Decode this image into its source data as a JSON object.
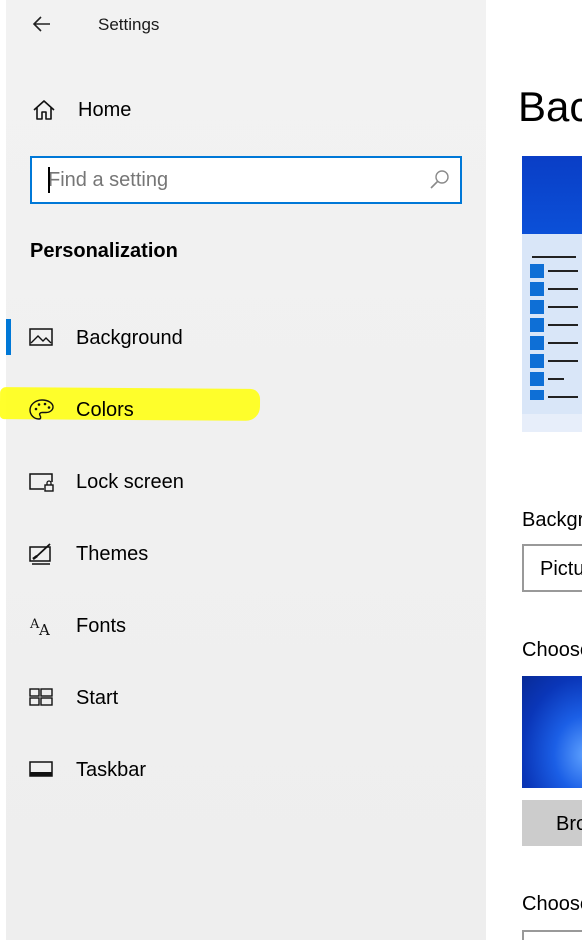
{
  "window": {
    "title": "Settings"
  },
  "sidebar": {
    "home_label": "Home",
    "search_placeholder": "Find a setting",
    "section_title": "Personalization",
    "items": [
      {
        "label": "Background",
        "icon": "picture-icon",
        "selected": true
      },
      {
        "label": "Colors",
        "icon": "palette-icon",
        "highlighted": true
      },
      {
        "label": "Lock screen",
        "icon": "lock-screen-icon"
      },
      {
        "label": "Themes",
        "icon": "themes-icon"
      },
      {
        "label": "Fonts",
        "icon": "fonts-icon"
      },
      {
        "label": "Start",
        "icon": "start-icon"
      },
      {
        "label": "Taskbar",
        "icon": "taskbar-icon"
      }
    ]
  },
  "main": {
    "title": "Bac",
    "background_label": "Backgr",
    "background_value": "Pictu",
    "choose_picture_label": "Choose",
    "browse_label": "Bro",
    "choose_fit_label": "Choose"
  },
  "colors": {
    "accent": "#0078d7",
    "highlight": "#ffff1a",
    "sidebar_bg": "#f2f2f2"
  }
}
